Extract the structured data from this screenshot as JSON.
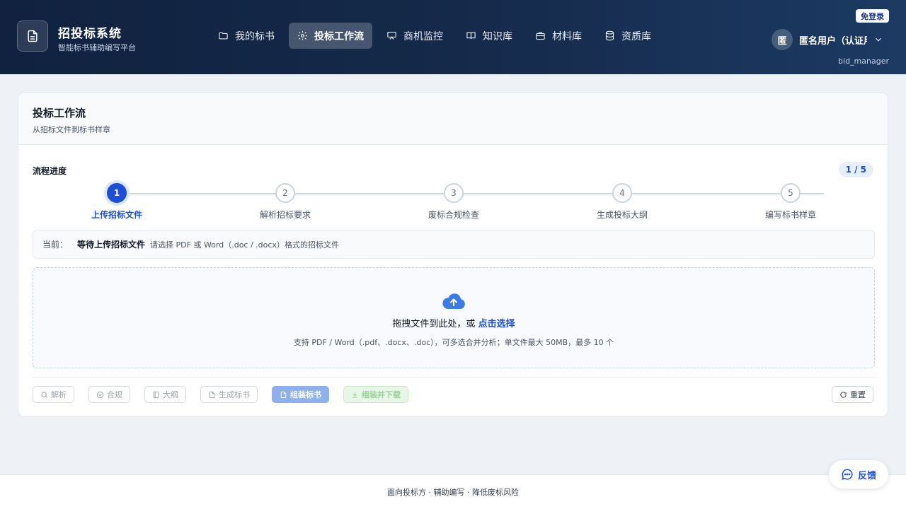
{
  "brand": {
    "title": "招投标系统",
    "subtitle": "智能标书辅助编写平台",
    "logo_icon": "document-icon"
  },
  "nav": {
    "items": [
      {
        "label": "我的标书",
        "icon": "folder-icon",
        "active": false
      },
      {
        "label": "投标工作流",
        "icon": "gear-icon",
        "active": true
      },
      {
        "label": "商机监控",
        "icon": "presentation-icon",
        "active": false
      },
      {
        "label": "知识库",
        "icon": "book-icon",
        "active": false
      },
      {
        "label": "材料库",
        "icon": "briefcase-icon",
        "active": false
      },
      {
        "label": "资质库",
        "icon": "database-icon",
        "active": false
      }
    ]
  },
  "user": {
    "login_badge": "免登录",
    "avatar_text": "匿",
    "name": "匿名用户（认证用户）",
    "role": "bid_manager"
  },
  "card": {
    "title": "投标工作流",
    "subtitle": "从招标文件到标书样章"
  },
  "progress": {
    "label": "流程进度",
    "count": "1 / 5",
    "current_step": 1,
    "steps": [
      {
        "num": "1",
        "label": "上传招标文件"
      },
      {
        "num": "2",
        "label": "解析招标要求"
      },
      {
        "num": "3",
        "label": "废标合规检查"
      },
      {
        "num": "4",
        "label": "生成投标大纲"
      },
      {
        "num": "5",
        "label": "编写标书样章"
      }
    ]
  },
  "current": {
    "prefix": "当前：",
    "status": "等待上传招标文件",
    "description": "请选择 PDF 或 Word（.doc / .docx）格式的招标文件"
  },
  "upload": {
    "icon": "cloud-upload-icon",
    "main_text": "拖拽文件到此处，或",
    "link_text": "点击选择",
    "hint": "支持 PDF / Word（.pdf、.docx、.doc），可多选合并分析；单文件最大 50MB，最多 10 个"
  },
  "actions": {
    "parse": "解析",
    "compliance": "合规",
    "outline": "大纲",
    "generate": "生成标书",
    "assemble": "组装标书",
    "assemble_download": "组装并下载",
    "reset": "重置"
  },
  "footer": {
    "text": "面向投标方 · 辅助编写 · 降低废标风险"
  },
  "feedback": {
    "label": "反馈",
    "icon": "chat-icon"
  },
  "colors": {
    "header_dark": "#10223f",
    "accent": "#1d4ed8",
    "upload_icon": "#3b7be8"
  }
}
